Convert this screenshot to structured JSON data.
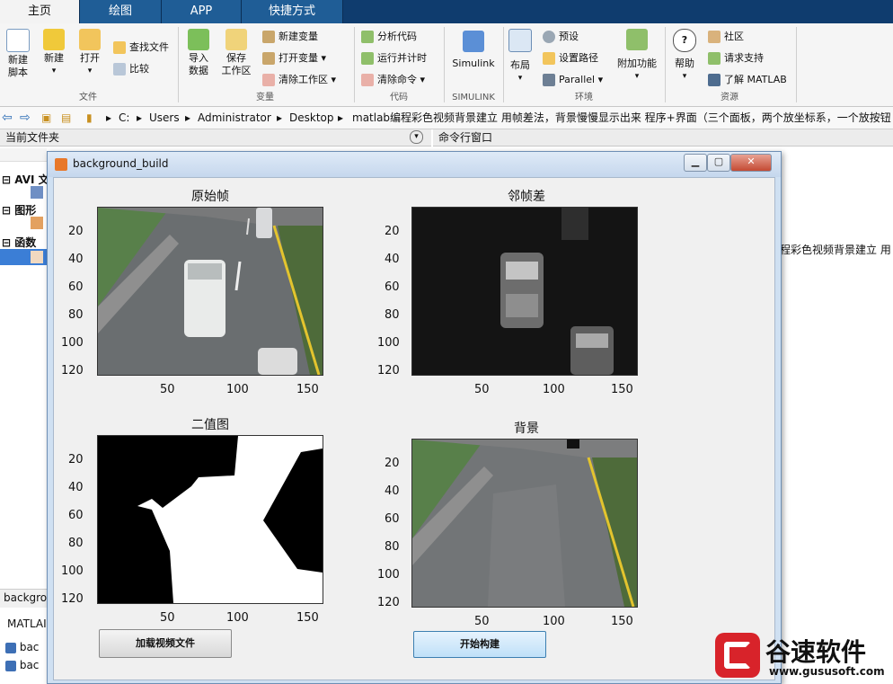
{
  "tabs": [
    {
      "label": "主页",
      "active": true
    },
    {
      "label": "绘图",
      "active": false
    },
    {
      "label": "APP",
      "active": false
    },
    {
      "label": "快捷方式",
      "active": false
    }
  ],
  "ribbon": {
    "file": {
      "new_script": "新建\n脚本",
      "new": "新建",
      "open": "打开",
      "find_files": "查找文件",
      "compare": "比较",
      "group": "文件"
    },
    "variable": {
      "import": "导入\n数据",
      "save_ws": "保存\n工作区",
      "new_var": "新建变量",
      "open_var": "打开变量",
      "clear_ws": "清除工作区",
      "group": "变量"
    },
    "code": {
      "analyze": "分析代码",
      "run_time": "运行并计时",
      "clear_cmd": "清除命令",
      "group": "代码"
    },
    "simulink": {
      "label": "Simulink",
      "group": "SIMULINK"
    },
    "env": {
      "layout": "布局",
      "prefs": "预设",
      "set_path": "设置路径",
      "parallel": "Parallel",
      "addons": "附加功能",
      "group": "环境"
    },
    "resources": {
      "help": "帮助",
      "community": "社区",
      "support": "请求支持",
      "learn": "了解 MATLAB",
      "group": "资源"
    }
  },
  "address": {
    "path": [
      "C:",
      "Users",
      "Administrator",
      "Desktop",
      "matlab编程彩色视频背景建立 用帧差法，背景慢慢显示出来   程序+界面（三个面板，两个放坐标系，一个放按钮"
    ]
  },
  "panels": {
    "current_folder": "当前文件夹",
    "command_window": "命令行窗口",
    "tree": [
      "AVI 文",
      "图形",
      "函数"
    ],
    "cmd_overflow": "程彩色视频背景建立  用",
    "bottom_tab": "backgro",
    "bottom_label": "MATLAI",
    "bottom_items": [
      "bac",
      "bac"
    ]
  },
  "figure": {
    "title": "background_build",
    "axes": [
      {
        "title": "原始帧",
        "yticks": [
          "20",
          "40",
          "60",
          "80",
          "100",
          "120"
        ],
        "xticks": [
          "50",
          "100",
          "150"
        ]
      },
      {
        "title": "邻帧差",
        "yticks": [
          "20",
          "40",
          "60",
          "80",
          "100",
          "120"
        ],
        "xticks": [
          "50",
          "100",
          "150"
        ]
      },
      {
        "title": "二值图",
        "yticks": [
          "20",
          "40",
          "60",
          "80",
          "100",
          "120"
        ],
        "xticks": [
          "50",
          "100",
          "150"
        ]
      },
      {
        "title": "背景",
        "yticks": [
          "20",
          "40",
          "60",
          "80",
          "100",
          "120"
        ],
        "xticks": [
          "50",
          "100",
          "150"
        ]
      }
    ],
    "load_button": "加载视频文件",
    "start_button": "开始构建"
  },
  "watermark": {
    "brand": "谷速软件",
    "url": "www.gususoft.com"
  }
}
